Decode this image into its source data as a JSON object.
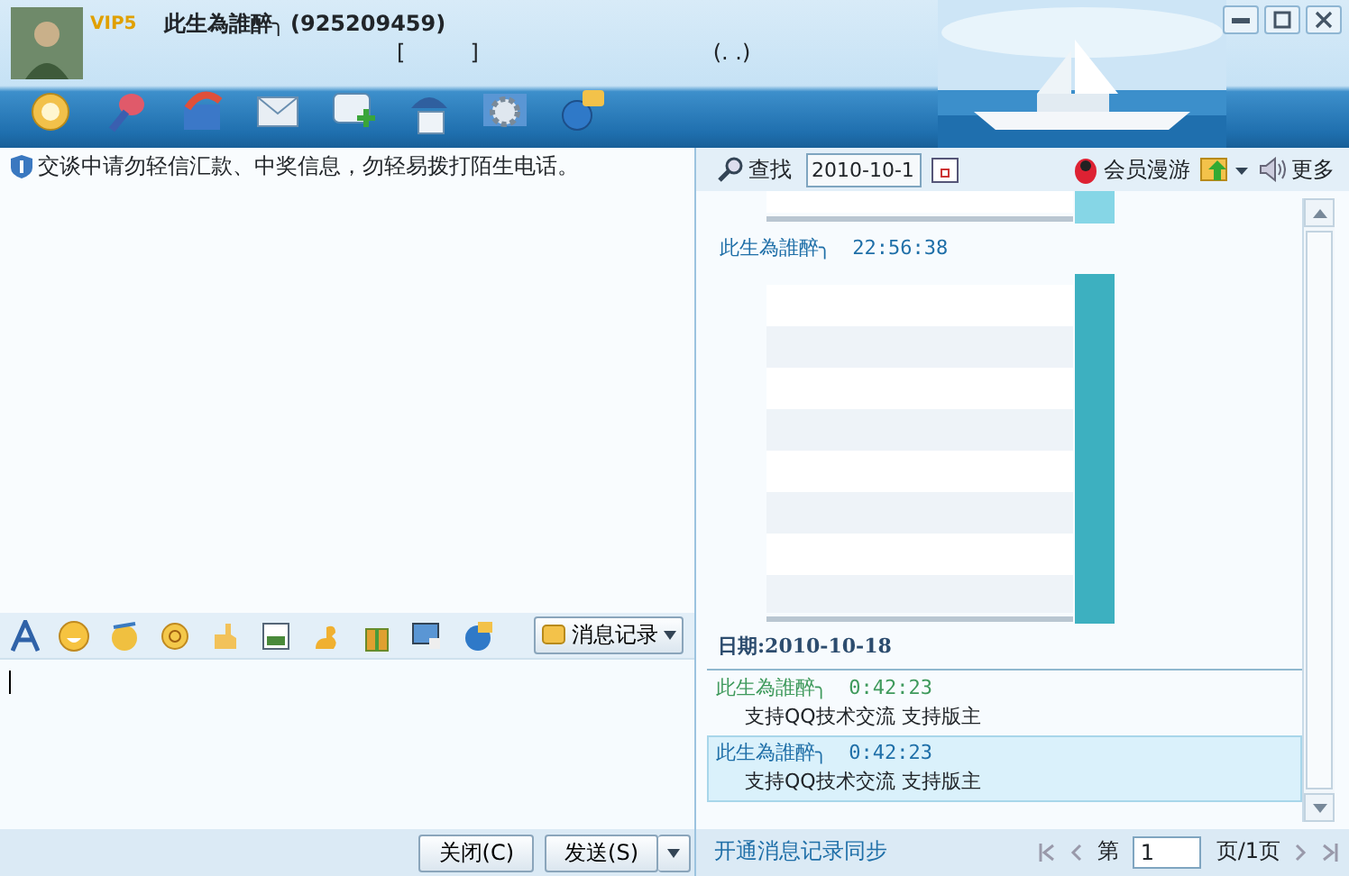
{
  "contact": {
    "name": "此生為誰醉╮",
    "number": "(925209459)",
    "vip": "VIP5",
    "line_2": [
      "[",
      "]",
      "(. .)"
    ]
  },
  "notice": "交谈中请勿轻信汇款、中奖信息，勿轻易拨打陌生电话。",
  "compose": {
    "history_button": "消息记录",
    "close_button": "关闭(C)",
    "send_button": "发送(S)"
  },
  "history_toolbar": {
    "search": "查找",
    "date": "2010-10-1",
    "roam": "会员漫游",
    "more": "更多"
  },
  "history": [
    {
      "kind": "picture"
    },
    {
      "kind": "message",
      "name": "此生為誰醉╮",
      "time": "22:56:38",
      "color": "#1f6fa8",
      "selected": false
    },
    {
      "kind": "picture"
    },
    {
      "kind": "date",
      "text": "日期:2010-10-18"
    },
    {
      "kind": "message",
      "name": "此生為誰醉╮",
      "time": "0:42:23",
      "text": "支持QQ技术交流 支持版主",
      "color": "#3f9a5c",
      "selected": false
    },
    {
      "kind": "message",
      "name": "此生為誰醉╮",
      "time": "0:42:23",
      "text": "支持QQ技术交流 支持版主",
      "color": "#1f6fa8",
      "selected": true
    }
  ],
  "footer": {
    "sync_link": "开通消息记录同步",
    "page_prefix": "第",
    "page": "1",
    "page_suffix": "页/1页"
  }
}
